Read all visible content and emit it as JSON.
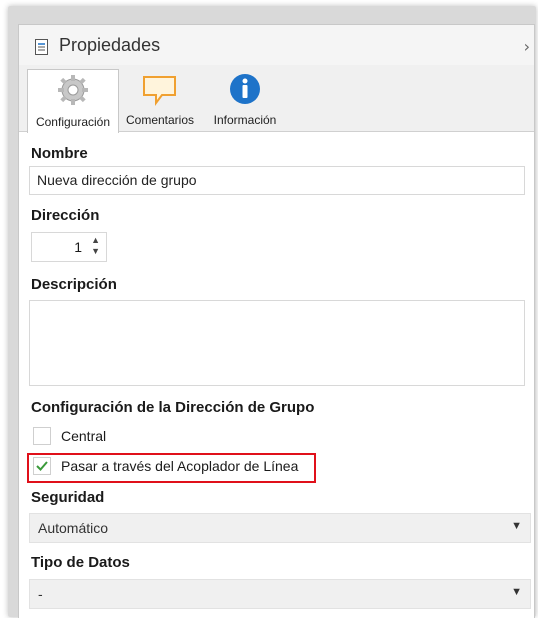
{
  "panel": {
    "title": "Propiedades",
    "collapse_glyph": "›"
  },
  "tabs": [
    {
      "label": "Configuración",
      "icon": "gear-icon",
      "active": true
    },
    {
      "label": "Comentarios",
      "icon": "comment-icon",
      "active": false
    },
    {
      "label": "Información",
      "icon": "info-icon",
      "active": false
    }
  ],
  "fields": {
    "name": {
      "label": "Nombre",
      "value": "Nueva dirección de grupo"
    },
    "address": {
      "label": "Dirección",
      "value": "1"
    },
    "description": {
      "label": "Descripción",
      "value": ""
    }
  },
  "group_config": {
    "heading": "Configuración de la Dirección de Grupo",
    "central": {
      "label": "Central",
      "checked": false
    },
    "pass_through": {
      "label": "Pasar a través del Acoplador de Línea",
      "checked": true
    }
  },
  "security": {
    "label": "Seguridad",
    "selected": "Automático"
  },
  "data_type": {
    "label": "Tipo de Datos",
    "selected": "-"
  },
  "colors": {
    "highlight_border": "#e0101a",
    "check_color": "#3a9a3a",
    "info_blue": "#1e73c9",
    "comment_orange": "#f0a030"
  }
}
